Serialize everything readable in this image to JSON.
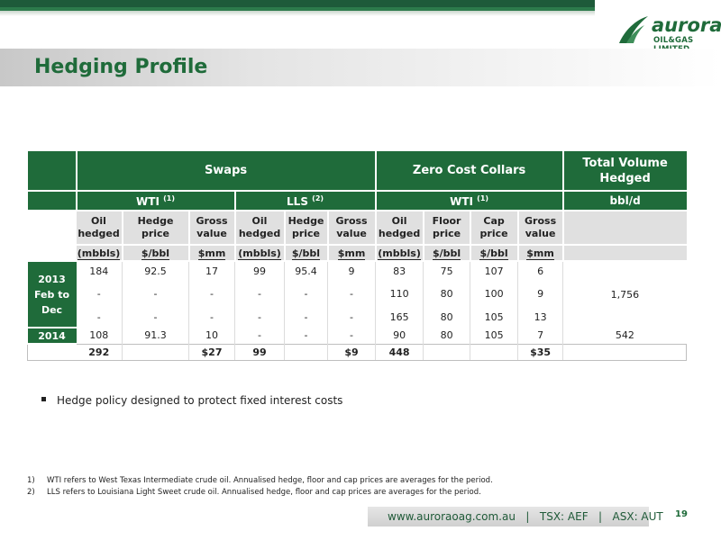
{
  "header": {
    "logo_word": "aurora",
    "logo_sub": "OIL&GAS LIMITED",
    "title": "Hedging Profile"
  },
  "colors": {
    "brand_green": "#1f6b3a",
    "header_grey": "#e0e0e0"
  },
  "table": {
    "groups": {
      "swaps": "Swaps",
      "collars": "Zero Cost Collars",
      "total": "Total Volume Hedged"
    },
    "subgroups": {
      "wti_swaps": "WTI",
      "wti_swaps_sup": "(1)",
      "lls": "LLS",
      "lls_sup": "(2)",
      "wti_collars": "WTI",
      "wti_collars_sup": "(1)",
      "bbl_d": "bbl/d"
    },
    "columns": [
      "Oil hedged",
      "Hedge price",
      "Gross value",
      "Oil hedged",
      "Hedge price",
      "Gross value",
      "Oil hedged",
      "Floor price",
      "Cap price",
      "Gross value"
    ],
    "units": [
      "(mbbls)",
      "$/bbl",
      "$mm",
      "(mbbls)",
      "$/bbl",
      "$mm",
      "(mbbls)",
      "$/bbl",
      "$/bbl",
      "$mm"
    ],
    "row_2013_label": "2013 Feb to Dec",
    "rows_2013": [
      [
        "184",
        "92.5",
        "17",
        "99",
        "95.4",
        "9",
        "83",
        "75",
        "107",
        "6"
      ],
      [
        "-",
        "-",
        "-",
        "-",
        "-",
        "-",
        "110",
        "80",
        "100",
        "9"
      ],
      [
        "-",
        "-",
        "-",
        "-",
        "-",
        "-",
        "165",
        "80",
        "105",
        "13"
      ]
    ],
    "total_2013": "1,756",
    "row_2014_label": "2014",
    "row_2014": [
      "108",
      "91.3",
      "10",
      "-",
      "-",
      "-",
      "90",
      "80",
      "105",
      "7"
    ],
    "total_2014": "542",
    "totals": [
      "292",
      "",
      "$27",
      "99",
      "",
      "$9",
      "448",
      "",
      "",
      "$35"
    ],
    "totals_volume": ""
  },
  "bullet": "Hedge policy designed to protect fixed interest costs",
  "footnotes": [
    {
      "n": "1)",
      "text": "WTI refers to West Texas Intermediate crude oil. Annualised hedge, floor and cap prices are averages for the period."
    },
    {
      "n": "2)",
      "text": "LLS refers to Louisiana Light Sweet crude oil. Annualised hedge, floor and cap prices are averages for the period."
    }
  ],
  "footer": {
    "text": "www.auroraoag.com.au   |   TSX: AEF   |   ASX: AUT",
    "page": "19"
  }
}
